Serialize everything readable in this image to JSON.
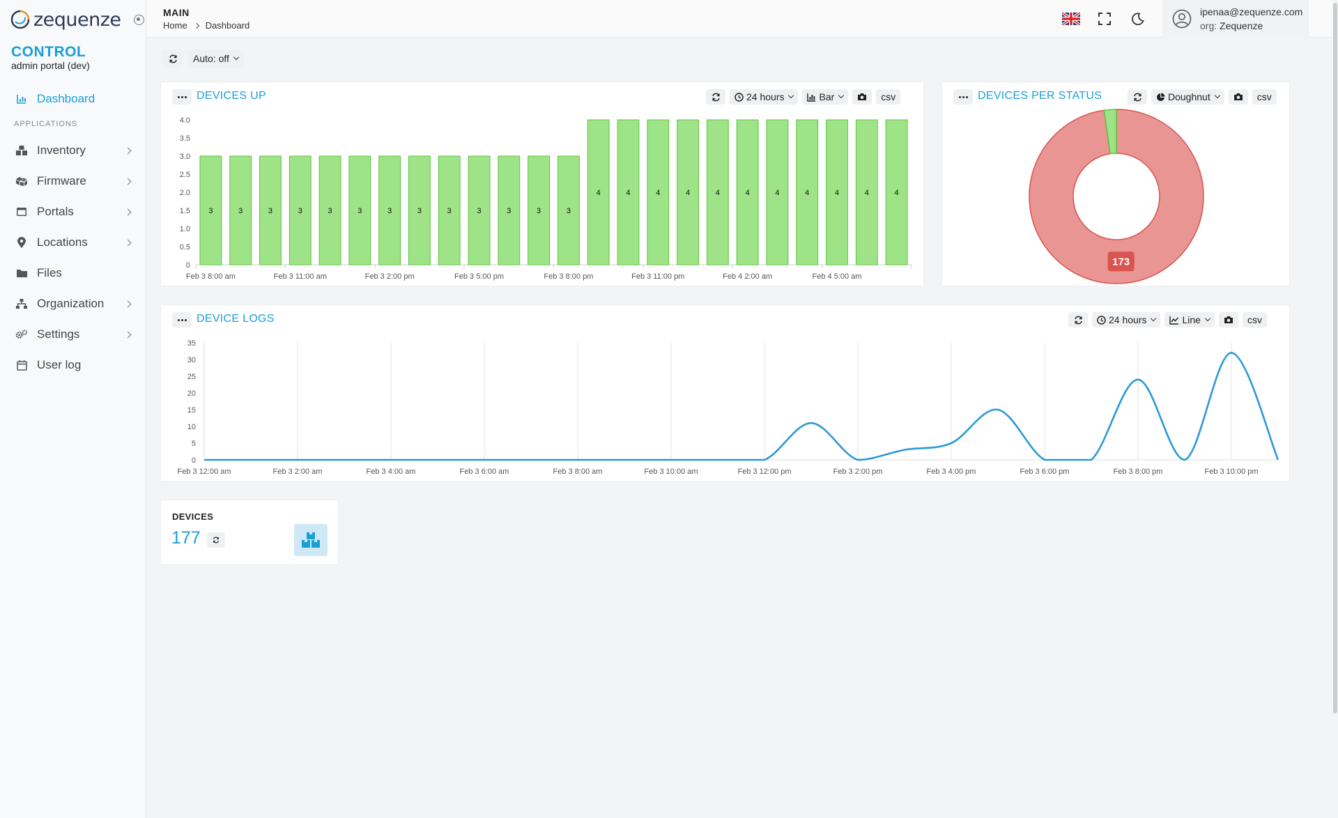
{
  "brand": {
    "logo_text": "zequenze",
    "title": "CONTROL",
    "subtitle": "admin portal (dev)"
  },
  "sidebar": {
    "section_label": "APPLICATIONS",
    "items": [
      {
        "label": "Dashboard",
        "icon": "chart-icon",
        "active": true
      },
      {
        "label": "Inventory",
        "icon": "boxes-icon",
        "has_children": true
      },
      {
        "label": "Firmware",
        "icon": "cubes-icon",
        "has_children": true
      },
      {
        "label": "Portals",
        "icon": "window-icon",
        "has_children": true
      },
      {
        "label": "Locations",
        "icon": "map-pin-icon",
        "has_children": true
      },
      {
        "label": "Files",
        "icon": "folder-icon",
        "has_children": false
      },
      {
        "label": "Organization",
        "icon": "sitemap-icon",
        "has_children": true
      },
      {
        "label": "Settings",
        "icon": "gears-icon",
        "has_children": true
      },
      {
        "label": "User log",
        "icon": "calendar-icon",
        "has_children": false
      }
    ]
  },
  "header": {
    "section": "MAIN",
    "breadcrumb": [
      "Home",
      "Dashboard"
    ],
    "user_email": "ipenaa@zequenze.com",
    "org_label": "org:",
    "org_name": "Zequenze"
  },
  "toolbar": {
    "auto_label": "Auto: off"
  },
  "devices_up": {
    "title": "DEVICES UP",
    "range": "24 hours",
    "chart_type": "Bar",
    "csv": "csv"
  },
  "devices_per_status": {
    "title": "DEVICES PER STATUS",
    "chart_type": "Doughnut",
    "csv": "csv"
  },
  "device_logs": {
    "title": "DEVICE LOGS",
    "range": "24 hours",
    "chart_type": "Line",
    "csv": "csv"
  },
  "devices_kpi": {
    "label": "DEVICES",
    "value": "177"
  },
  "colors": {
    "accent": "#1a9fd6",
    "bar_fill": "#9ee387",
    "bar_stroke": "#5cc43c",
    "slice_red": "#e89593",
    "slice_red_stroke": "#d9534f",
    "slice_green": "#9ee387",
    "line": "#2a98d8"
  },
  "chart_data": [
    {
      "type": "bar",
      "title": "DEVICES UP",
      "categories": [
        "Feb 3 8:00 am",
        "",
        "",
        "Feb 3 11:00 am",
        "",
        "",
        "Feb 3 2:00 pm",
        "",
        "",
        "Feb 3 5:00 pm",
        "",
        "",
        "Feb 3 8:00 pm",
        "",
        "",
        "Feb 3 11:00 pm",
        "",
        "",
        "Feb 4 2:00 am",
        "",
        "",
        "Feb 4 5:00 am",
        "",
        "",
        ""
      ],
      "values": [
        3,
        3,
        3,
        3,
        3,
        3,
        3,
        3,
        3,
        3,
        3,
        3,
        3,
        4,
        4,
        4,
        4,
        4,
        4,
        4,
        4,
        4,
        4,
        4
      ],
      "yticks": [
        "0",
        "0.5",
        "1.0",
        "1.5",
        "2.0",
        "2.5",
        "3.0",
        "3.5",
        "4.0"
      ],
      "ylim": [
        0,
        4
      ],
      "data_labels": true
    },
    {
      "type": "pie",
      "title": "DEVICES PER STATUS",
      "variant": "doughnut",
      "slices": [
        {
          "value": 173,
          "label": "173",
          "color": "#e89593"
        },
        {
          "value": 4,
          "color": "#9ee387"
        }
      ]
    },
    {
      "type": "line",
      "title": "DEVICE LOGS",
      "xticks": [
        "Feb 3 12:00 am",
        "Feb 3 2:00 am",
        "Feb 3 4:00 am",
        "Feb 3 6:00 am",
        "Feb 3 8:00 am",
        "Feb 3 10:00 am",
        "Feb 3 12:00 pm",
        "Feb 3 2:00 pm",
        "Feb 3 4:00 pm",
        "Feb 3 6:00 pm",
        "Feb 3 8:00 pm",
        "Feb 3 10:00 pm"
      ],
      "x": [
        "Feb 3 12:00 am",
        "Feb 3 1:00 am",
        "Feb 3 2:00 am",
        "Feb 3 3:00 am",
        "Feb 3 4:00 am",
        "Feb 3 5:00 am",
        "Feb 3 6:00 am",
        "Feb 3 7:00 am",
        "Feb 3 8:00 am",
        "Feb 3 9:00 am",
        "Feb 3 10:00 am",
        "Feb 3 11:00 am",
        "Feb 3 12:00 pm",
        "Feb 3 1:00 pm",
        "Feb 3 2:00 pm",
        "Feb 3 3:00 pm",
        "Feb 3 4:00 pm",
        "Feb 3 5:00 pm",
        "Feb 3 6:00 pm",
        "Feb 3 7:00 pm",
        "Feb 3 8:00 pm",
        "Feb 3 9:00 pm",
        "Feb 3 10:00 pm",
        "Feb 3 11:00 pm"
      ],
      "values": [
        0,
        0,
        0,
        0,
        0,
        0,
        0,
        0,
        0,
        0,
        0,
        0,
        0,
        11,
        0,
        3,
        5,
        15,
        0,
        0,
        24,
        0,
        32,
        0
      ],
      "yticks": [
        "0",
        "5",
        "10",
        "15",
        "20",
        "25",
        "30",
        "35"
      ],
      "ylim": [
        0,
        35
      ],
      "grid": "vertical"
    }
  ]
}
